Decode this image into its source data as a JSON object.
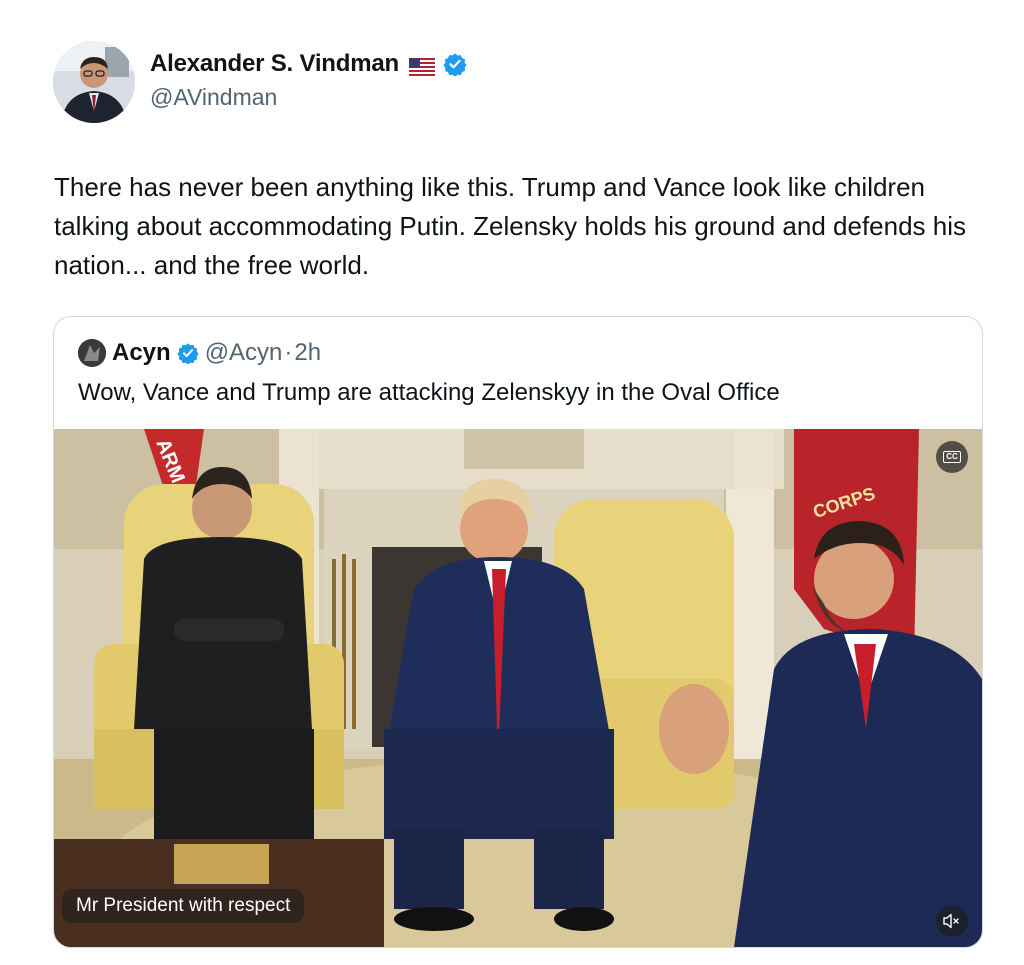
{
  "tweet": {
    "author_name": "Alexander S. Vindman",
    "author_handle": "@AVindman",
    "flag_icon": "us-flag-icon",
    "verified_icon": "verified-badge-icon",
    "verified_color": "#1d9bf0",
    "text": "There has never been anything like this. Trump and Vance look like children talking about accommodating Putin. Zelensky holds his ground and defends his nation... and the free world."
  },
  "quote": {
    "author_name": "Acyn",
    "author_handle": "@Acyn",
    "separator": "·",
    "time": "2h",
    "text": "Wow, Vance and Trump are attacking Zelenskyy in the Oval Office",
    "media": {
      "caption": "Mr President with respect",
      "cc_label": "CC",
      "cc_icon": "closed-captions-icon",
      "mute_icon": "speaker-muted-icon",
      "flag_text_left": "ARM",
      "flag_text_right": "CORPS"
    }
  }
}
